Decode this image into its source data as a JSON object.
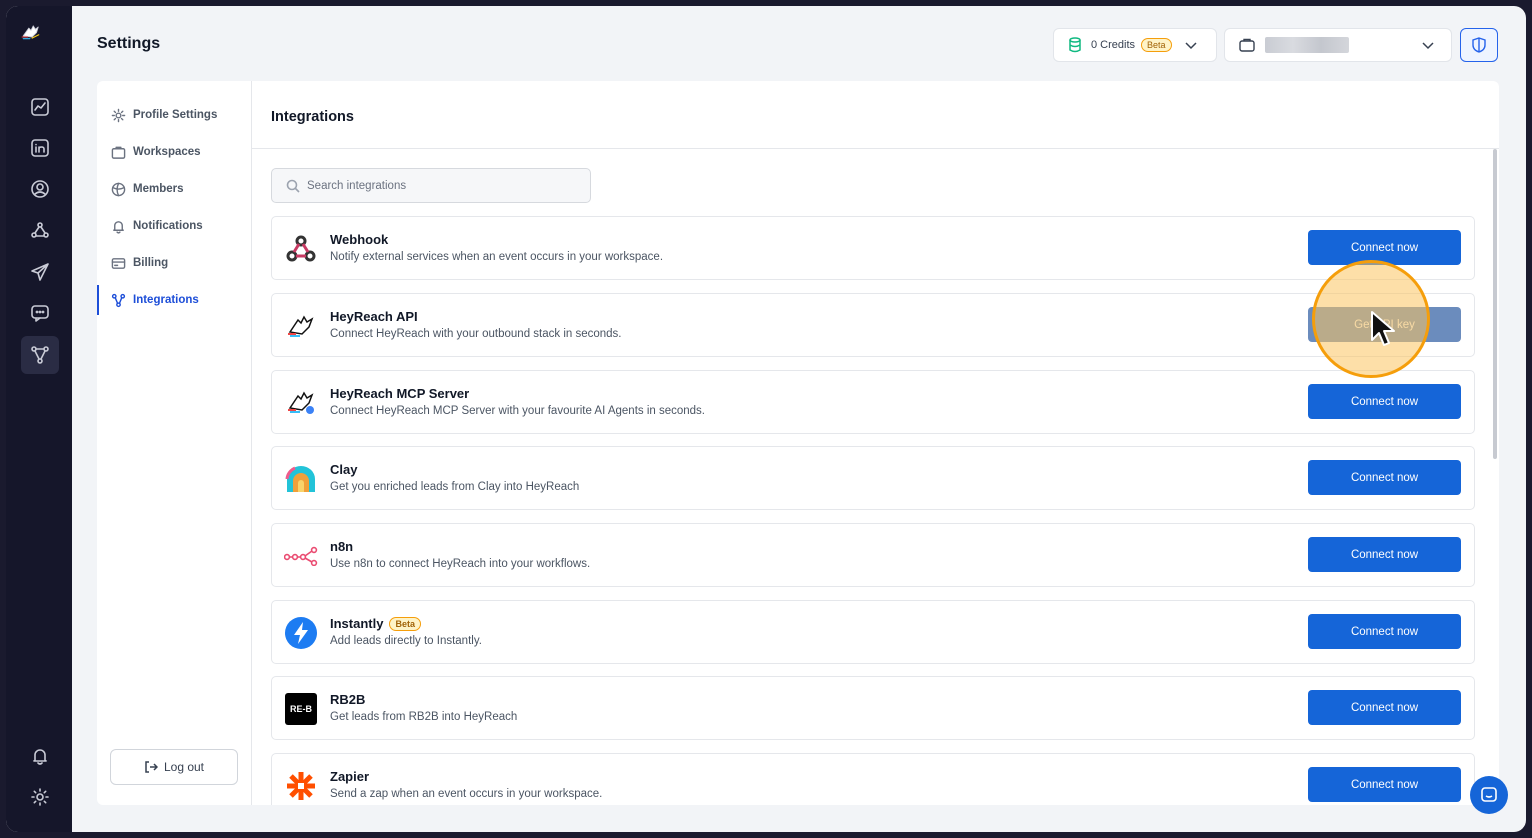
{
  "header": {
    "title": "Settings"
  },
  "credits": {
    "label": "0 Credits",
    "badge": "Beta"
  },
  "settings_nav": {
    "items": [
      {
        "label": "Profile Settings"
      },
      {
        "label": "Workspaces"
      },
      {
        "label": "Members"
      },
      {
        "label": "Notifications"
      },
      {
        "label": "Billing"
      },
      {
        "label": "Integrations"
      }
    ],
    "logout_label": "Log out"
  },
  "main": {
    "title": "Integrations",
    "search_placeholder": "Search integrations"
  },
  "integrations": [
    {
      "name": "Webhook",
      "description": "Notify external services when an event occurs in your workspace.",
      "button": "Connect now"
    },
    {
      "name": "HeyReach API",
      "description": "Connect HeyReach with your outbound stack in seconds.",
      "button": "Get API key"
    },
    {
      "name": "HeyReach MCP Server",
      "description": "Connect HeyReach MCP Server with your favourite AI Agents in seconds.",
      "button": "Connect now"
    },
    {
      "name": "Clay",
      "description": "Get you enriched leads from Clay into HeyReach",
      "button": "Connect now"
    },
    {
      "name": "n8n",
      "description": "Use n8n to connect HeyReach into your workflows.",
      "button": "Connect now"
    },
    {
      "name": "Instantly",
      "badge": "Beta",
      "description": "Add leads directly to Instantly.",
      "button": "Connect now"
    },
    {
      "name": "RB2B",
      "logo_text": "RE-B",
      "description": "Get leads from RB2B into HeyReach",
      "button": "Connect now"
    },
    {
      "name": "Zapier",
      "description": "Send a zap when an event occurs in your workspace.",
      "button": "Connect now"
    }
  ],
  "colors": {
    "primary": "#1565d8",
    "rail": "#15162a",
    "highlight": "#f59e0b"
  }
}
